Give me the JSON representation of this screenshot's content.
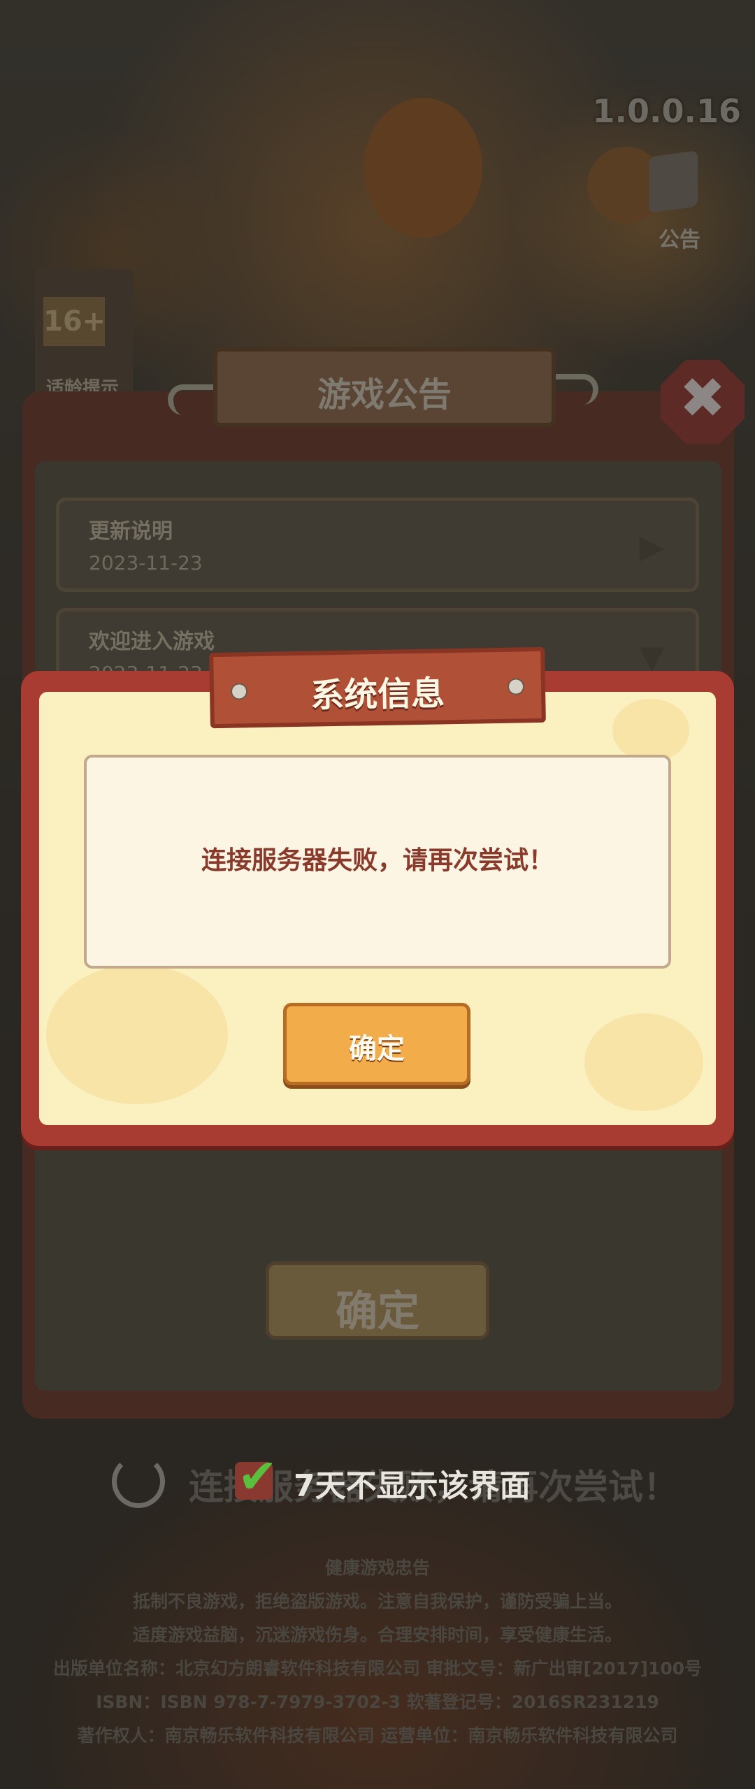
{
  "app": {
    "version": "1.0.0.16",
    "notice_label": "公告",
    "age_badge": {
      "rating": "16+",
      "label": "适龄提示"
    }
  },
  "announcement": {
    "title": "游戏公告",
    "items": [
      {
        "title": "更新说明",
        "date": "2023-11-23",
        "arrow": "▶"
      },
      {
        "title": "欢迎进入游戏",
        "date": "2023-11-23",
        "arrow": "▼"
      }
    ],
    "confirm_label": "确定",
    "close_icon": "✖"
  },
  "loading": {
    "text": "连接服务器失败，请再次尝试！",
    "checkbox_checked": true,
    "checkbox_label": "7天不显示该界面"
  },
  "footer": {
    "lines": [
      "健康游戏忠告",
      "抵制不良游戏，拒绝盗版游戏。注意自我保护，谨防受骗上当。",
      "适度游戏益脑，沉迷游戏伤身。合理安排时间，享受健康生活。",
      "出版单位名称：北京幻方朗睿软件科技有限公司  审批文号：新广出审[2017]100号",
      "ISBN：ISBN 978-7-7979-3702-3  软著登记号：2016SR231219",
      "著作权人：南京畅乐软件科技有限公司  运营单位：南京畅乐软件科技有限公司"
    ]
  },
  "system_dialog": {
    "title": "系统信息",
    "message": "连接服务器失败，请再次尝试！",
    "confirm_label": "确定"
  },
  "colors": {
    "dialog_frame": "#a83b32",
    "dialog_body": "#fbf0c0",
    "button": "#f2ac4a",
    "checkmark": "#5bbf3e"
  }
}
